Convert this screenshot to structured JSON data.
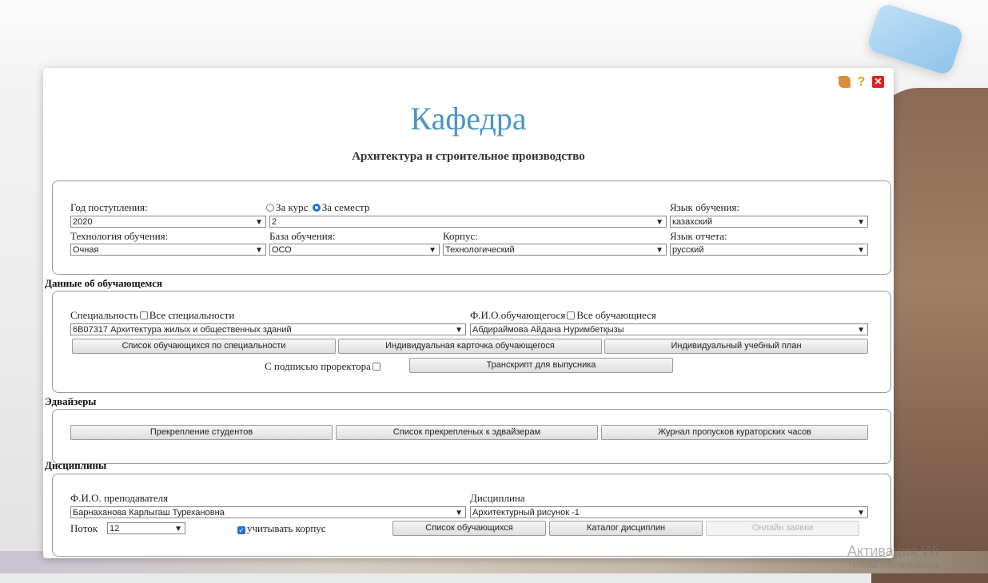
{
  "page": {
    "title": "Кафедра",
    "subtitle": "Архитектура и строительное производство"
  },
  "filters": {
    "year_label": "Год поступления:",
    "year_value": "2020",
    "period_course_label": "За курс",
    "period_semester_label": "За семестр",
    "period_selected": "semester",
    "period_value": "2",
    "lang_label": "Язык обучения:",
    "lang_value": "казахский",
    "tech_label": "Технология обучения:",
    "tech_value": "Очная",
    "base_label": "База обучения:",
    "base_value": "ОСО",
    "corpus_label": "Корпус:",
    "corpus_value": "Технологический",
    "report_lang_label": "Язык отчета:",
    "report_lang_value": "русский"
  },
  "student": {
    "section_title": "Данные об обучающемся",
    "specialty_label": "Специальность",
    "all_specialties_label": "Все специальности",
    "specialty_value": "6B07317 Архитектура жилых и общественных зданий",
    "fio_label": "Ф.И.О.обучающегося",
    "all_students_label": "Все обучающиеся",
    "fio_value": "Абдираймова Айдана Нуримбетқызы",
    "btn_list": "Список обучающихся по специальности",
    "btn_card": "Индивидуальная карточка обучающегося",
    "btn_plan": "Индивидуальный учебный план",
    "prorector_label": "С подписью проректора",
    "btn_transcript": "Транскрипт для выпусника"
  },
  "advisers": {
    "section_title": "Эдвайзеры",
    "btn_attach": "Прекрепление студентов",
    "btn_list": "Список прекрепленых к эдвайзерам",
    "btn_journal": "Журнал пропусков кураторских часов"
  },
  "disciplines": {
    "section_title": "Дисциплины",
    "teacher_label": "Ф.И.О. преподавателя",
    "teacher_value": "Барнаханова Карлыгаш Турехановна",
    "discipline_label": "Дисциплина",
    "discipline_value": "Архитектурный рисунок -1",
    "stream_label": "Поток",
    "stream_value": "12",
    "consider_corpus_label": "учитывать корпус",
    "btn_students": "Список обучающихся",
    "btn_catalog": "Каталог дисциплин",
    "btn_online": "Онлайн заявки"
  },
  "watermark": {
    "line1": "Активация Wi",
    "line2": "Чтобы активировать"
  },
  "colors": {
    "title": "#4a96c4",
    "accent": "#1e73d8",
    "close": "#dd2222"
  }
}
